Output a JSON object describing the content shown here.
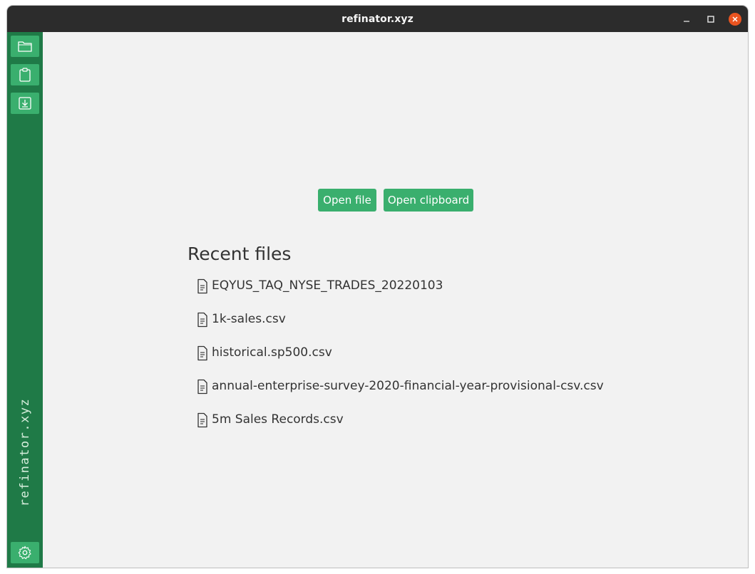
{
  "window": {
    "title": "refinator.xyz"
  },
  "sidebar": {
    "brand": "refinator.xyz",
    "buttons": [
      {
        "icon": "folder-icon"
      },
      {
        "icon": "clipboard-icon"
      },
      {
        "icon": "import-icon"
      }
    ],
    "settings_icon": "gear-icon"
  },
  "main": {
    "open_file_label": "Open file",
    "open_clipboard_label": "Open clipboard",
    "recent_title": "Recent files",
    "recent_files": [
      "EQYUS_TAQ_NYSE_TRADES_20220103",
      "1k-sales.csv",
      "historical.sp500.csv",
      "annual-enterprise-survey-2020-financial-year-provisional-csv.csv",
      "5m Sales Records.csv"
    ]
  },
  "colors": {
    "sidebar": "#1f7a47",
    "accent": "#3aaf6e",
    "titlebar": "#2c2c2c",
    "close": "#e95420"
  }
}
